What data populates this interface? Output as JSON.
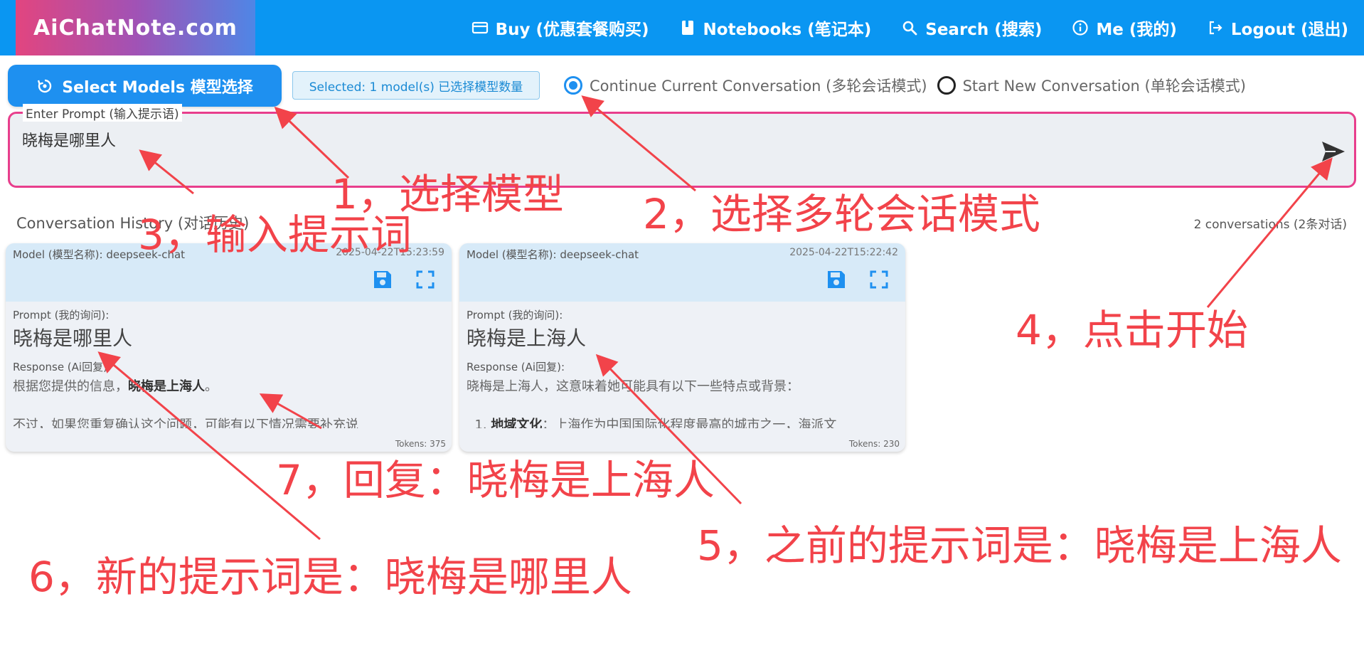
{
  "navbar": {
    "brand": "AiChatNote.com",
    "items": [
      {
        "label": "Buy (优惠套餐购买)",
        "icon": "credit-card-icon"
      },
      {
        "label": "Notebooks (笔记本)",
        "icon": "book-icon"
      },
      {
        "label": "Search (搜索)",
        "icon": "search-icon"
      },
      {
        "label": "Me (我的)",
        "icon": "info-icon"
      },
      {
        "label": "Logout (退出)",
        "icon": "logout-icon"
      }
    ]
  },
  "toolbar": {
    "select_models_label": "Select Models 模型选择",
    "selected_count": "Selected: 1 model(s) 已选择模型数量",
    "mode_continue": "Continue Current Conversation (多轮会话模式)",
    "mode_new": "Start New Conversation (单轮会话模式)"
  },
  "prompt": {
    "legend": "Enter Prompt (输入提示语)",
    "value": "晓梅是哪里人"
  },
  "history": {
    "title": "Conversation History (对话历史)",
    "count": "2 conversations (2条对话)",
    "cards": [
      {
        "model": "Model (模型名称): deepseek-chat",
        "time": "2025-04-22T15:23:59",
        "prompt_label": "Prompt (我的询问):",
        "prompt": "晓梅是哪里人",
        "response_label": "Response (Ai回复):",
        "response_pre": "根据您提供的信息，",
        "response_bold": "晓梅是上海人",
        "response_post": "。",
        "response_line2": "不过，如果您重复确认这个问题，可能有以下情况需要补充说",
        "tokens": "Tokens: 375"
      },
      {
        "model": "Model (模型名称): deepseek-chat",
        "time": "2025-04-22T15:22:42",
        "prompt_label": "Prompt (我的询问):",
        "prompt": "晓梅是上海人",
        "response_label": "Response (Ai回复):",
        "response_line1": "晓梅是上海人，这意味着她可能具有以下一些特点或背景：",
        "response_item_num": "1.",
        "response_item_bold": "地域文化",
        "response_item_rest": "：上海作为中国国际化程度最高的城市之一，海派文",
        "tokens": "Tokens: 230"
      }
    ]
  },
  "annotations": [
    "1，选择模型",
    "2，选择多轮会话模式",
    "3，输入提示词",
    "4，点击开始",
    "5，之前的提示词是：晓梅是上海人",
    "6，新的提示词是：晓梅是哪里人",
    "7，回复：晓梅是上海人"
  ],
  "colors": {
    "nav_bg": "#0a96f2",
    "accent": "#1e90f0",
    "prompt_border": "#e83e8c",
    "annotation": "#f2434a"
  }
}
